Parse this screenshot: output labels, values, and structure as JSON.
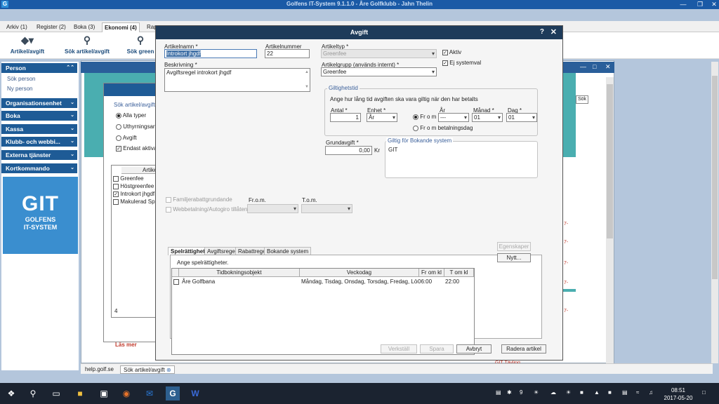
{
  "window": {
    "title": "Golfens IT-System 9.1.1.0 - Åre Golfklubb - Jahn Thelin",
    "app_icon": "G"
  },
  "menu_tabs": [
    "Arkiv (1)",
    "Register (2)",
    "Boka (3)",
    "Ekonomi (4)",
    "Rap"
  ],
  "toolbar": {
    "artikel": "Artikel/avgift",
    "sok_artikel": "Sök artikel/avgift",
    "sok_green": "Sök green"
  },
  "sidebar": {
    "person": "Person",
    "sok_person": "Sök person",
    "ny_person": "Ny person",
    "organisation": "Organisationsenhet",
    "boka": "Boka",
    "kassa": "Kassa",
    "klubb": "Klubb- och webbi...",
    "externa": "Externa tjänster",
    "kortkommando": "Kortkommando",
    "logo_big": "GIT",
    "logo_line1": "GOLFENS",
    "logo_line2": "IT-SYSTEM"
  },
  "search_panel": {
    "title": "Sök artikel/avgift",
    "alla_typer": "Alla typer",
    "uthyrning": "Uthyrningsarti",
    "avgift": "Avgift",
    "endast_aktiva": "Endast aktiva",
    "col_artikel": "Artike",
    "rows": [
      "Greenfee",
      "Höstgreenfee",
      "Introkort jhgdf",
      "Makulerad Spe"
    ],
    "count": "4",
    "read_more": "Läs mer",
    "sok_btn": "Sök"
  },
  "dialog": {
    "title": "Avgift",
    "help": "?",
    "close": "✕",
    "artikelnamn_label": "Artikelnamn *",
    "artikelnamn_value": "Introkort jhgdf",
    "artikelnummer_label": "Artikelnummer",
    "artikelnummer_value": "22",
    "artikeltyp_label": "Artikeltyp *",
    "artikeltyp_value": "Greenfee",
    "aktiv_label": "Aktiv",
    "ej_systemval_label": "Ej systemval",
    "beskrivning_label": "Beskrivning *",
    "beskrivning_value": "Avgiftsregel introkort jhgdf",
    "artikelgrupp_label": "Artikelgrupp (används internt) *",
    "artikelgrupp_value": "Greenfee",
    "giltighetstid_title": "Giltighetstid",
    "giltighet_text": "Ange hur lång tid avgiften ska vara giltig när den har betalts",
    "antal_label": "Antal *",
    "antal_value": "1",
    "enhet_label": "Enhet *",
    "enhet_value": "År",
    "from_label": "Fr o m",
    "from_bet_label": "Fr o m betalningsdag",
    "ar_label": "År",
    "ar_value": "---",
    "manad_label": "Månad *",
    "manad_value": "01",
    "dag_label": "Dag *",
    "dag_value": "01",
    "grundavgift_label": "Grundavgift *",
    "grundavgift_value": "0,00",
    "grundavgift_unit": "Kr",
    "giltig_bokande_title": "Giltig för Bokande system",
    "giltig_bokande_value": "GIT",
    "familj_label": "Familjerabattgrundande",
    "webbetalning_label": "Webbetalning/Autogiro tillåten",
    "from_short": "Fr.o.m.",
    "tom_short": "T.o.m.",
    "tabs": [
      "Spelrättighet",
      "Avgiftsregel",
      "Rabattregel",
      "Bokande system"
    ],
    "spel_text": "Ange spelrättigheter.",
    "grid_headers": [
      "Tidbokningsobjekt",
      "Veckodag",
      "Fr om kl",
      "T om kl"
    ],
    "grid_rows": [
      {
        "objekt": "Åre Golfbana",
        "veckodag": "Måndag, Tisdag, Onsdag, Torsdag, Fredag, Lörda",
        "from": "06:00",
        "tom": "22:00"
      }
    ],
    "egenskaper_btn": "Egenskaper",
    "nytt_btn": "Nytt...",
    "verkstall_btn": "Verkställ",
    "spara_btn": "Spara",
    "avbryt_btn": "Avbryt",
    "radera_btn": "Radera artikel"
  },
  "bottom_tabs": [
    "help.golf.se",
    "Sök artikel/avgift"
  ],
  "taskbar": {
    "time": "08:51",
    "date": "2017-05-20",
    "badge": "9"
  },
  "background": {
    "red1": "7-",
    "red2": "7-",
    "red3": "7-",
    "red4": "7-",
    "red5": "7-",
    "red6": "GIT Tävling"
  }
}
